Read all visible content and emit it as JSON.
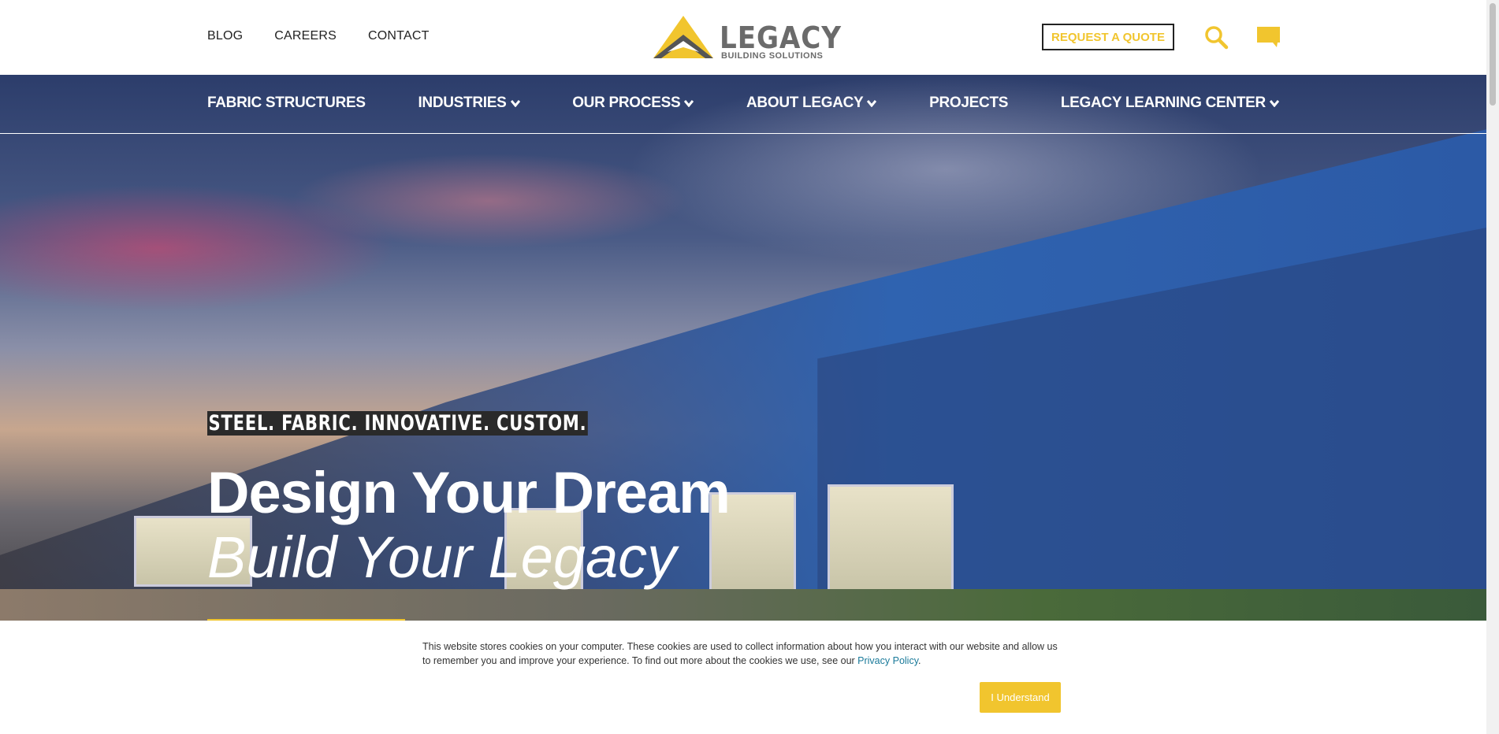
{
  "header": {
    "top_links": [
      "BLOG",
      "CAREERS",
      "CONTACT"
    ],
    "logo": {
      "word": "LEGACY",
      "sub": "BUILDING SOLUTIONS"
    },
    "quote_label": "REQUEST A QUOTE",
    "icons": [
      "search-icon",
      "chat-icon"
    ]
  },
  "nav": {
    "items": [
      {
        "label": "FABRIC STRUCTURES",
        "dropdown": false
      },
      {
        "label": "INDUSTRIES",
        "dropdown": true
      },
      {
        "label": "OUR PROCESS",
        "dropdown": true
      },
      {
        "label": "ABOUT LEGACY",
        "dropdown": true
      },
      {
        "label": "PROJECTS",
        "dropdown": false
      },
      {
        "label": "LEGACY LEARNING CENTER",
        "dropdown": true
      }
    ]
  },
  "hero": {
    "tagline": "STEEL. FABRIC. INNOVATIVE. CUSTOM.",
    "title": "Design Your Dream",
    "subtitle": "Build Your Legacy"
  },
  "cookie": {
    "text": "This website stores cookies on your computer. These cookies are used to collect information about how you interact with our website and allow us to remember you and improve your experience. To find out more about the cookies we use, see our ",
    "link": "Privacy Policy",
    "end": ".",
    "button": "I Understand"
  },
  "colors": {
    "accent": "#f1c52e",
    "text": "#222222",
    "link": "#1a7a9a"
  }
}
